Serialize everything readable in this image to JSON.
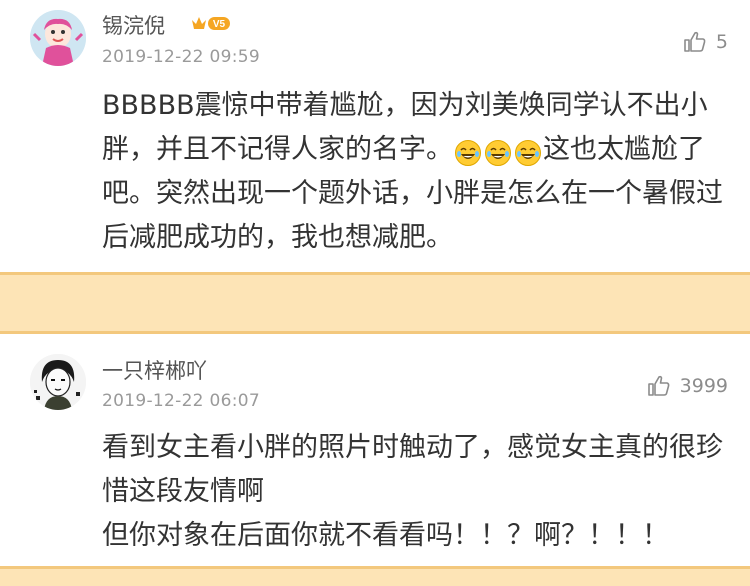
{
  "comments": [
    {
      "username": "锡浣倪",
      "vip_badge": "V5",
      "timestamp": "2019-12-22 09:59",
      "likes": "5",
      "text_before_emoji": "BBBBB震惊中带着尴尬，因为刘美焕同学认不出小胖，并且不记得人家的名字。",
      "emoji_name": "laughing-crying-emoji",
      "emoji_count": 3,
      "text_after_emoji": "这也太尴尬了吧。突然出现一个题外话，小胖是怎么在一个暑假过后减肥成功的，我也想减肥。"
    },
    {
      "username": "一只梓郴吖",
      "timestamp": "2019-12-22 06:07",
      "likes": "3999",
      "text_line1": "看到女主看小胖的照片时触动了，感觉女主真的很珍惜这段友情啊",
      "text_line2": "但你对象在后面你就不看看吗！！？啊？！！！"
    }
  ],
  "colors": {
    "separator_fill": "#fde4b6",
    "separator_border": "#f3c87d",
    "vip_badge": "#f5a623",
    "text": "#333333",
    "meta": "#9a9a9a"
  },
  "icons": [
    "thumbs-up-icon",
    "vip-crown-icon",
    "laughing-crying-emoji"
  ]
}
